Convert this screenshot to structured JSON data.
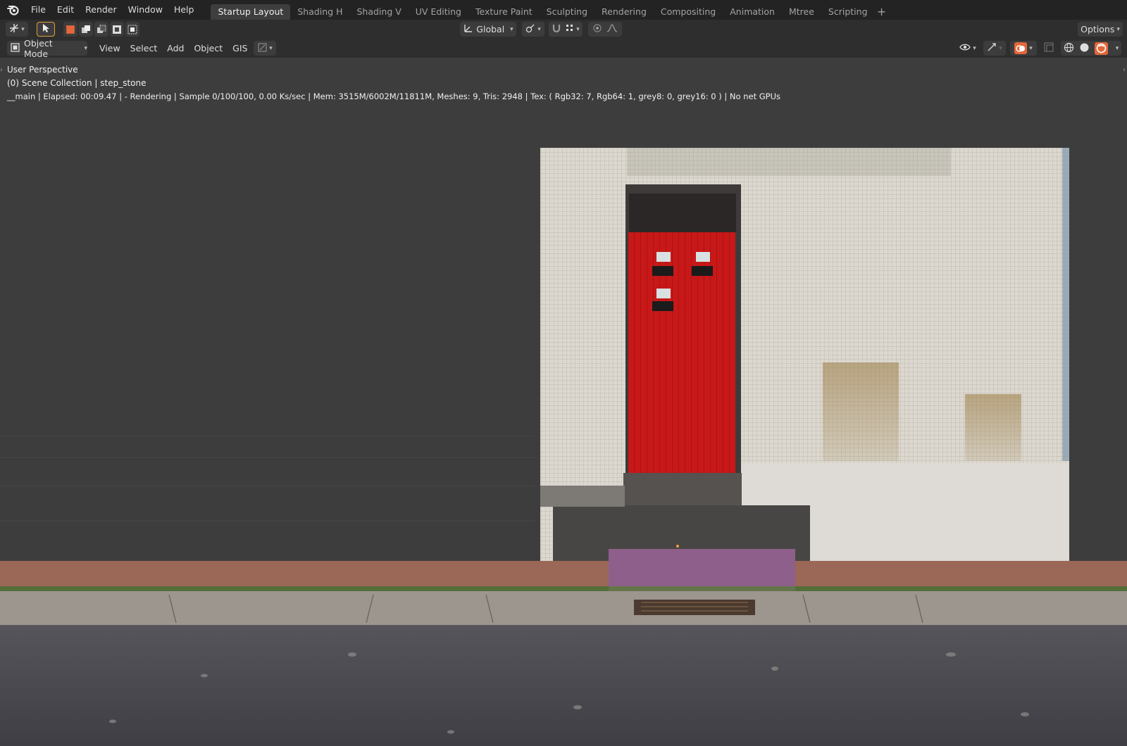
{
  "menu": {
    "items": [
      "File",
      "Edit",
      "Render",
      "Window",
      "Help"
    ]
  },
  "workspaces": {
    "tabs": [
      "Startup Layout",
      "Shading H",
      "Shading V",
      "UV Editing",
      "Texture Paint",
      "Sculpting",
      "Rendering",
      "Compositing",
      "Animation",
      "Mtree",
      "Scripting"
    ],
    "active": "Startup Layout",
    "add_label": "+"
  },
  "tool_header": {
    "transform_orientation": "Global",
    "options_label": "Options"
  },
  "viewport_header": {
    "mode": "Object Mode",
    "menus": [
      "View",
      "Select",
      "Add",
      "Object",
      "GIS"
    ]
  },
  "viewport_overlay": {
    "perspective": "User Perspective",
    "collection": "(0) Scene Collection | step_stone",
    "render_status": "__main | Elapsed: 00:09.47 |  - Rendering | Sample 0/100/100, 0.00 Ks/sec | Mem: 3515M/6002M/11811M, Meshes: 9, Tris: 2948 | Tex: ( Rgb32: 7, Rgb64: 1, grey8: 0, grey16: 0 ) | No net GPUs"
  },
  "icons": {
    "logo": "blender-logo-icon",
    "select": "select-tool-icon",
    "render_shading": "rendered-shading-icon"
  },
  "colors": {
    "accent": "#e4663a",
    "door_red": "#c81818",
    "step_stone": "#8d5f8a",
    "ground_strip": "#9b6757"
  }
}
